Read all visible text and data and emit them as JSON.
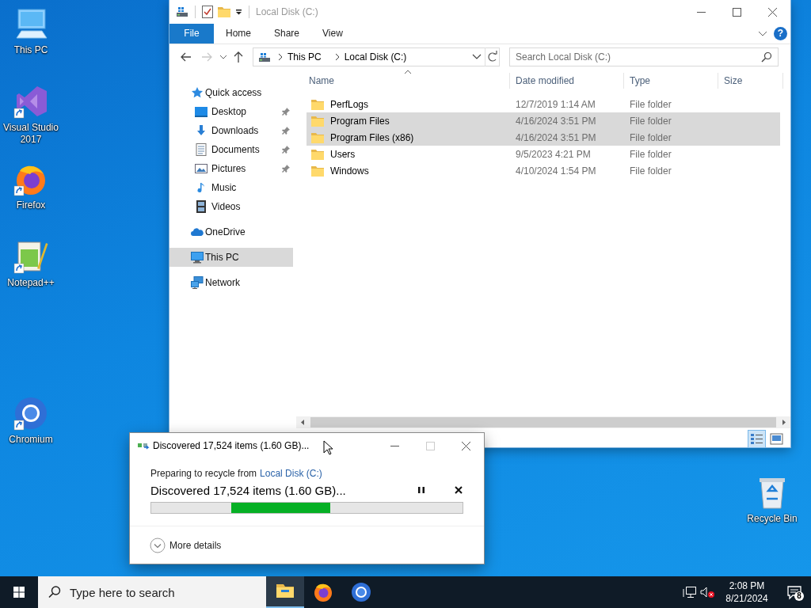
{
  "desktop_icons": [
    {
      "label": "This PC",
      "kind": "pc",
      "shortcut": false
    },
    {
      "label": "Visual Studio 2017",
      "kind": "vs",
      "shortcut": true
    },
    {
      "label": "Firefox",
      "kind": "firefox",
      "shortcut": true
    },
    {
      "label": "Notepad++",
      "kind": "notepad",
      "shortcut": true
    },
    {
      "label": "Chromium",
      "kind": "chromium",
      "shortcut": true
    }
  ],
  "recycle_bin": {
    "label": "Recycle Bin",
    "kind": "recycle",
    "shortcut": false
  },
  "explorer": {
    "title": "Local Disk (C:)",
    "ribbon_tabs": [
      {
        "label": "File",
        "kind": "file"
      },
      {
        "label": "Home",
        "kind": "tab"
      },
      {
        "label": "Share",
        "kind": "tab"
      },
      {
        "label": "View",
        "kind": "tab"
      }
    ],
    "help": "?",
    "address": [
      "This PC",
      "Local Disk (C:)"
    ],
    "search": {
      "placeholder": "Search Local Disk (C:)"
    },
    "columns": [
      "Name",
      "Date modified",
      "Type",
      "Size"
    ],
    "nav": [
      {
        "label": "Quick access",
        "kind": "star",
        "selected": false,
        "children": [
          {
            "label": "Desktop",
            "kind": "desktop",
            "pinned": true,
            "selected": false
          },
          {
            "label": "Downloads",
            "kind": "downloads",
            "pinned": true,
            "selected": false
          },
          {
            "label": "Documents",
            "kind": "documents",
            "pinned": true,
            "selected": false
          },
          {
            "label": "Pictures",
            "kind": "pictures",
            "pinned": true,
            "selected": false
          },
          {
            "label": "Music",
            "kind": "music",
            "pinned": false,
            "selected": false
          },
          {
            "label": "Videos",
            "kind": "videos",
            "pinned": false,
            "selected": false
          }
        ]
      },
      {
        "label": "OneDrive",
        "kind": "onedrive",
        "selected": false
      },
      {
        "label": "This PC",
        "kind": "pc",
        "selected": true
      },
      {
        "label": "Network",
        "kind": "network",
        "selected": false
      }
    ],
    "rows": [
      {
        "name": "PerfLogs",
        "date": "12/7/2019 1:14 AM",
        "type": "File folder",
        "selected": false
      },
      {
        "name": "Program Files",
        "date": "4/16/2024 3:51 PM",
        "type": "File folder",
        "selected": true
      },
      {
        "name": "Program Files (x86)",
        "date": "4/16/2024 3:51 PM",
        "type": "File folder",
        "selected": true
      },
      {
        "name": "Users",
        "date": "9/5/2023 4:21 PM",
        "type": "File folder",
        "selected": false
      },
      {
        "name": "Windows",
        "date": "4/10/2024 1:54 PM",
        "type": "File folder",
        "selected": false
      }
    ],
    "view_buttons": [
      {
        "kind": "details",
        "selected": true
      },
      {
        "kind": "tiles",
        "selected": false
      }
    ]
  },
  "dialog": {
    "title": "Discovered 17,524 items (1.60 GB)...",
    "source_prefix": "Preparing to recycle from",
    "source_link": "Local Disk (C:)",
    "status": "Discovered 17,524 items (1.60 GB)...",
    "progress": {
      "kind": "marquee"
    },
    "more_details": "More details"
  },
  "taskbar": {
    "search_placeholder": "Type here to search",
    "apps": [
      {
        "kind": "explorer",
        "active": true
      },
      {
        "kind": "firefox",
        "active": false
      },
      {
        "kind": "chromium",
        "active": false
      }
    ],
    "volume_muted": true,
    "time": "2:08 PM",
    "date": "8/21/2024",
    "notification_count": "8"
  }
}
